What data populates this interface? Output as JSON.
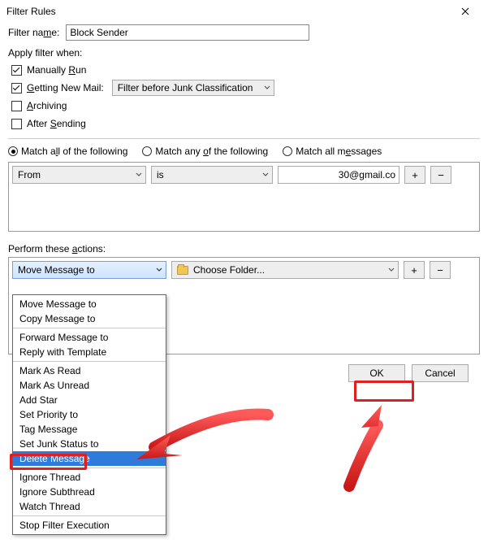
{
  "window": {
    "title": "Filter Rules"
  },
  "filter": {
    "name_label": "Filter name:",
    "name_value": "Block Sender"
  },
  "apply": {
    "label": "Apply filter when:",
    "manually_run": "Manually Run",
    "getting_new_mail": "Getting New Mail:",
    "archiving": "Archiving",
    "after_sending": "After Sending",
    "filter_before": "Filter before Junk Classification"
  },
  "match": {
    "all_following": "Match all of the following",
    "any_following": "Match any of the following",
    "all_messages": "Match all messages"
  },
  "condition": {
    "field": "From",
    "op": "is",
    "value": "30@gmail.co"
  },
  "btn": {
    "plus": "+",
    "minus": "−"
  },
  "perform": {
    "label": "Perform these actions:"
  },
  "action": {
    "selected": "Move Message to",
    "folder": "Choose Folder..."
  },
  "options": {
    "g1": [
      "Move Message to",
      "Copy Message to"
    ],
    "g2": [
      "Forward Message to",
      "Reply with Template"
    ],
    "g3": [
      "Mark As Read",
      "Mark As Unread",
      "Add Star",
      "Set Priority to",
      "Tag Message",
      "Set Junk Status to",
      "Delete Message"
    ],
    "g4": [
      "Ignore Thread",
      "Ignore Subthread",
      "Watch Thread"
    ],
    "g5": [
      "Stop Filter Execution"
    ]
  },
  "highlight": "Delete Message",
  "dialog": {
    "ok": "OK",
    "cancel": "Cancel"
  },
  "icons": {
    "close": "close-icon",
    "chevron": "chevron-down-icon",
    "folder": "folder-icon"
  }
}
